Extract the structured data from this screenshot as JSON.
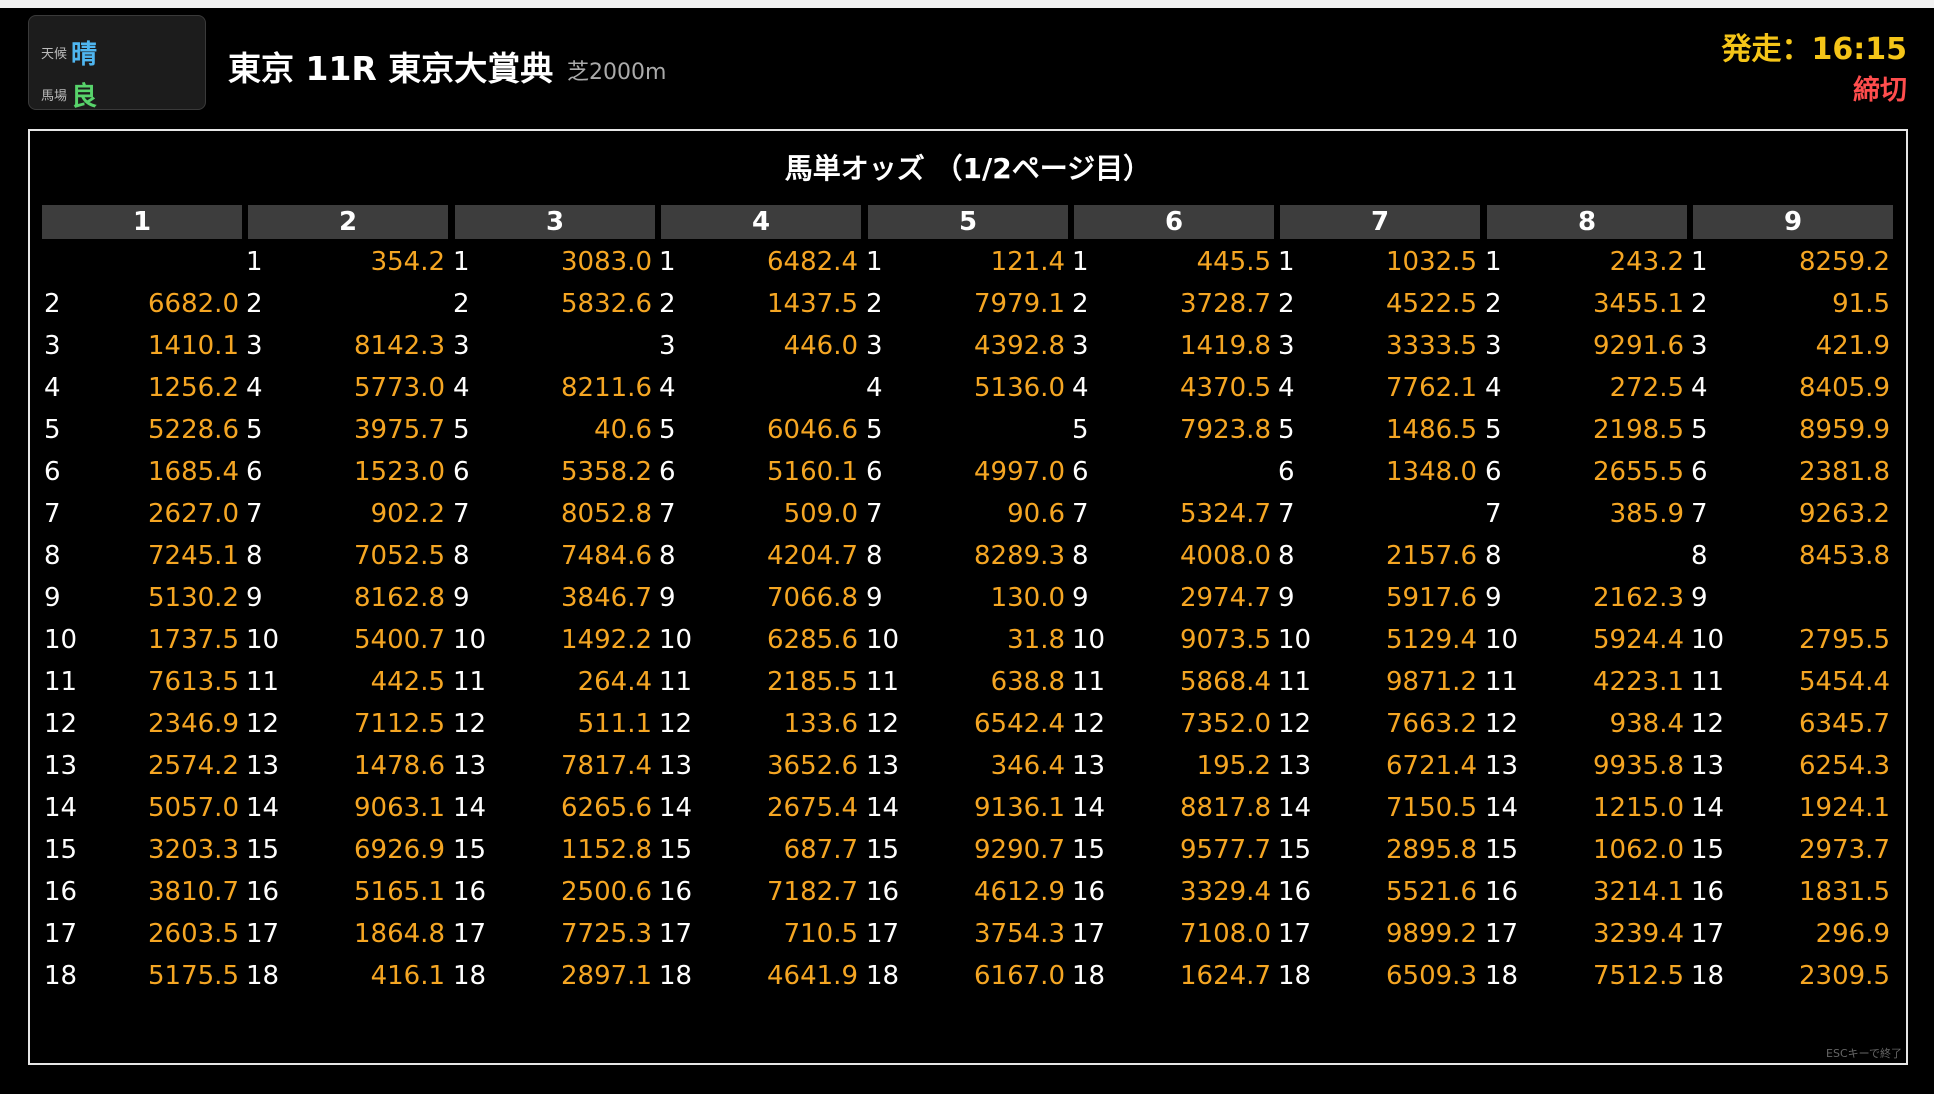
{
  "weather": {
    "label": "天候",
    "value": "晴",
    "value_color": "#4fb6f0"
  },
  "track": {
    "label": "馬場",
    "value": "良",
    "value_color": "#58d36b"
  },
  "race": {
    "title": "東京 11R 東京大賞典",
    "distance": "芝2000m"
  },
  "start": {
    "text": "発走：16:15"
  },
  "status": {
    "text": "締切"
  },
  "odds": {
    "title": "馬単オッズ （1/2ページ目）",
    "columns": [
      "1",
      "2",
      "3",
      "4",
      "5",
      "6",
      "7",
      "8",
      "9"
    ],
    "rows": [
      [
        [
          "1",
          ""
        ],
        [
          "1",
          "354.2"
        ],
        [
          "1",
          "3083.0"
        ],
        [
          "1",
          "6482.4"
        ],
        [
          "1",
          "121.4"
        ],
        [
          "1",
          "445.5"
        ],
        [
          "1",
          "1032.5"
        ],
        [
          "1",
          "243.2"
        ],
        [
          "1",
          "8259.2"
        ]
      ],
      [
        [
          "2",
          "6682.0"
        ],
        [
          "2",
          ""
        ],
        [
          "2",
          "5832.6"
        ],
        [
          "2",
          "1437.5"
        ],
        [
          "2",
          "7979.1"
        ],
        [
          "2",
          "3728.7"
        ],
        [
          "2",
          "4522.5"
        ],
        [
          "2",
          "3455.1"
        ],
        [
          "2",
          "91.5"
        ]
      ],
      [
        [
          "3",
          "1410.1"
        ],
        [
          "3",
          "8142.3"
        ],
        [
          "3",
          ""
        ],
        [
          "3",
          "446.0"
        ],
        [
          "3",
          "4392.8"
        ],
        [
          "3",
          "1419.8"
        ],
        [
          "3",
          "3333.5"
        ],
        [
          "3",
          "9291.6"
        ],
        [
          "3",
          "421.9"
        ]
      ],
      [
        [
          "4",
          "1256.2"
        ],
        [
          "4",
          "5773.0"
        ],
        [
          "4",
          "8211.6"
        ],
        [
          "4",
          ""
        ],
        [
          "4",
          "5136.0"
        ],
        [
          "4",
          "4370.5"
        ],
        [
          "4",
          "7762.1"
        ],
        [
          "4",
          "272.5"
        ],
        [
          "4",
          "8405.9"
        ]
      ],
      [
        [
          "5",
          "5228.6"
        ],
        [
          "5",
          "3975.7"
        ],
        [
          "5",
          "40.6"
        ],
        [
          "5",
          "6046.6"
        ],
        [
          "5",
          ""
        ],
        [
          "5",
          "7923.8"
        ],
        [
          "5",
          "1486.5"
        ],
        [
          "5",
          "2198.5"
        ],
        [
          "5",
          "8959.9"
        ]
      ],
      [
        [
          "6",
          "1685.4"
        ],
        [
          "6",
          "1523.0"
        ],
        [
          "6",
          "5358.2"
        ],
        [
          "6",
          "5160.1"
        ],
        [
          "6",
          "4997.0"
        ],
        [
          "6",
          ""
        ],
        [
          "6",
          "1348.0"
        ],
        [
          "6",
          "2655.5"
        ],
        [
          "6",
          "2381.8"
        ]
      ],
      [
        [
          "7",
          "2627.0"
        ],
        [
          "7",
          "902.2"
        ],
        [
          "7",
          "8052.8"
        ],
        [
          "7",
          "509.0"
        ],
        [
          "7",
          "90.6"
        ],
        [
          "7",
          "5324.7"
        ],
        [
          "7",
          ""
        ],
        [
          "7",
          "385.9"
        ],
        [
          "7",
          "9263.2"
        ]
      ],
      [
        [
          "8",
          "7245.1"
        ],
        [
          "8",
          "7052.5"
        ],
        [
          "8",
          "7484.6"
        ],
        [
          "8",
          "4204.7"
        ],
        [
          "8",
          "8289.3"
        ],
        [
          "8",
          "4008.0"
        ],
        [
          "8",
          "2157.6"
        ],
        [
          "8",
          ""
        ],
        [
          "8",
          "8453.8"
        ]
      ],
      [
        [
          "9",
          "5130.2"
        ],
        [
          "9",
          "8162.8"
        ],
        [
          "9",
          "3846.7"
        ],
        [
          "9",
          "7066.8"
        ],
        [
          "9",
          "130.0"
        ],
        [
          "9",
          "2974.7"
        ],
        [
          "9",
          "5917.6"
        ],
        [
          "9",
          "2162.3"
        ],
        [
          "9",
          ""
        ]
      ],
      [
        [
          "10",
          "1737.5"
        ],
        [
          "10",
          "5400.7"
        ],
        [
          "10",
          "1492.2"
        ],
        [
          "10",
          "6285.6"
        ],
        [
          "10",
          "31.8"
        ],
        [
          "10",
          "9073.5"
        ],
        [
          "10",
          "5129.4"
        ],
        [
          "10",
          "5924.4"
        ],
        [
          "10",
          "2795.5"
        ]
      ],
      [
        [
          "11",
          "7613.5"
        ],
        [
          "11",
          "442.5"
        ],
        [
          "11",
          "264.4"
        ],
        [
          "11",
          "2185.5"
        ],
        [
          "11",
          "638.8"
        ],
        [
          "11",
          "5868.4"
        ],
        [
          "11",
          "9871.2"
        ],
        [
          "11",
          "4223.1"
        ],
        [
          "11",
          "5454.4"
        ]
      ],
      [
        [
          "12",
          "2346.9"
        ],
        [
          "12",
          "7112.5"
        ],
        [
          "12",
          "511.1"
        ],
        [
          "12",
          "133.6"
        ],
        [
          "12",
          "6542.4"
        ],
        [
          "12",
          "7352.0"
        ],
        [
          "12",
          "7663.2"
        ],
        [
          "12",
          "938.4"
        ],
        [
          "12",
          "6345.7"
        ]
      ],
      [
        [
          "13",
          "2574.2"
        ],
        [
          "13",
          "1478.6"
        ],
        [
          "13",
          "7817.4"
        ],
        [
          "13",
          "3652.6"
        ],
        [
          "13",
          "346.4"
        ],
        [
          "13",
          "195.2"
        ],
        [
          "13",
          "6721.4"
        ],
        [
          "13",
          "9935.8"
        ],
        [
          "13",
          "6254.3"
        ]
      ],
      [
        [
          "14",
          "5057.0"
        ],
        [
          "14",
          "9063.1"
        ],
        [
          "14",
          "6265.6"
        ],
        [
          "14",
          "2675.4"
        ],
        [
          "14",
          "9136.1"
        ],
        [
          "14",
          "8817.8"
        ],
        [
          "14",
          "7150.5"
        ],
        [
          "14",
          "1215.0"
        ],
        [
          "14",
          "1924.1"
        ]
      ],
      [
        [
          "15",
          "3203.3"
        ],
        [
          "15",
          "6926.9"
        ],
        [
          "15",
          "1152.8"
        ],
        [
          "15",
          "687.7"
        ],
        [
          "15",
          "9290.7"
        ],
        [
          "15",
          "9577.7"
        ],
        [
          "15",
          "2895.8"
        ],
        [
          "15",
          "1062.0"
        ],
        [
          "15",
          "2973.7"
        ]
      ],
      [
        [
          "16",
          "3810.7"
        ],
        [
          "16",
          "5165.1"
        ],
        [
          "16",
          "2500.6"
        ],
        [
          "16",
          "7182.7"
        ],
        [
          "16",
          "4612.9"
        ],
        [
          "16",
          "3329.4"
        ],
        [
          "16",
          "5521.6"
        ],
        [
          "16",
          "3214.1"
        ],
        [
          "16",
          "1831.5"
        ]
      ],
      [
        [
          "17",
          "2603.5"
        ],
        [
          "17",
          "1864.8"
        ],
        [
          "17",
          "7725.3"
        ],
        [
          "17",
          "710.5"
        ],
        [
          "17",
          "3754.3"
        ],
        [
          "17",
          "7108.0"
        ],
        [
          "17",
          "9899.2"
        ],
        [
          "17",
          "3239.4"
        ],
        [
          "17",
          "296.9"
        ]
      ],
      [
        [
          "18",
          "5175.5"
        ],
        [
          "18",
          "416.1"
        ],
        [
          "18",
          "2897.1"
        ],
        [
          "18",
          "4641.9"
        ],
        [
          "18",
          "6167.0"
        ],
        [
          "18",
          "1624.7"
        ],
        [
          "18",
          "6509.3"
        ],
        [
          "18",
          "7512.5"
        ],
        [
          "18",
          "2309.5"
        ]
      ]
    ]
  },
  "footer": {
    "hint": "ESCキーで終了"
  }
}
